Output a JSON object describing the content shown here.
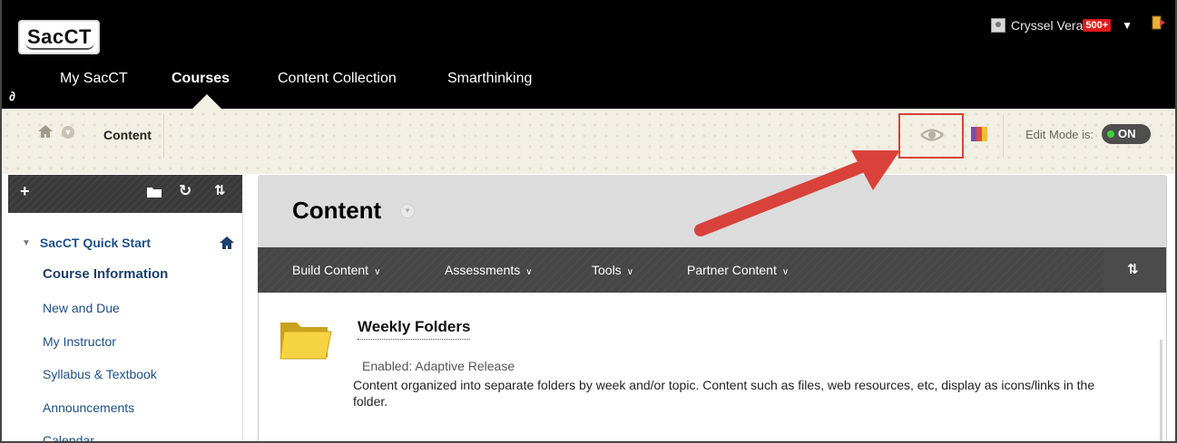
{
  "header": {
    "logo_text": "SacCT",
    "nav_tabs": [
      {
        "label": "My SacCT",
        "active": false
      },
      {
        "label": "Courses",
        "active": true
      },
      {
        "label": "Content Collection",
        "active": false
      },
      {
        "label": "Smarthinking",
        "active": false
      }
    ],
    "user_name": "Cryssel Vera",
    "notification_badge": "500+",
    "icons": [
      "link-icon",
      "user-avatar-icon",
      "chevron-down-icon",
      "logout-icon"
    ]
  },
  "breadcrumb": {
    "current": "Content",
    "icons": [
      "home-icon",
      "chevron-down-icon"
    ]
  },
  "page_tools": {
    "edit_mode_label": "Edit Mode is:",
    "edit_mode_state": "ON",
    "icons": [
      "eye-preview-icon",
      "color-palette-icon"
    ],
    "toggle_color": "#3fd13f"
  },
  "sidebar": {
    "toolbar_icons": [
      "plus-icon",
      "folder-icon",
      "refresh-icon",
      "sort-icon"
    ],
    "course_name": "SacCT Quick Start",
    "items": [
      {
        "label": "Course Information",
        "active": true
      },
      {
        "label": "New and Due",
        "active": false
      },
      {
        "label": "My Instructor",
        "active": false
      },
      {
        "label": "Syllabus & Textbook",
        "active": false
      },
      {
        "label": "Announcements",
        "active": false
      },
      {
        "label": "Calendar",
        "active": false
      }
    ]
  },
  "main": {
    "title": "Content",
    "action_menus": [
      {
        "label": "Build Content"
      },
      {
        "label": "Assessments"
      },
      {
        "label": "Tools"
      },
      {
        "label": "Partner Content"
      }
    ],
    "sort_icon": "sort-icon",
    "items": [
      {
        "title": "Weekly Folders",
        "status": "Enabled:  Adaptive Release",
        "description": "Content organized into separate folders by week and/or topic.  Content such as files, web resources, etc, display as icons/links in the folder.",
        "icon": "folder-icon"
      }
    ]
  },
  "annotation": {
    "color": "#d9413b"
  }
}
